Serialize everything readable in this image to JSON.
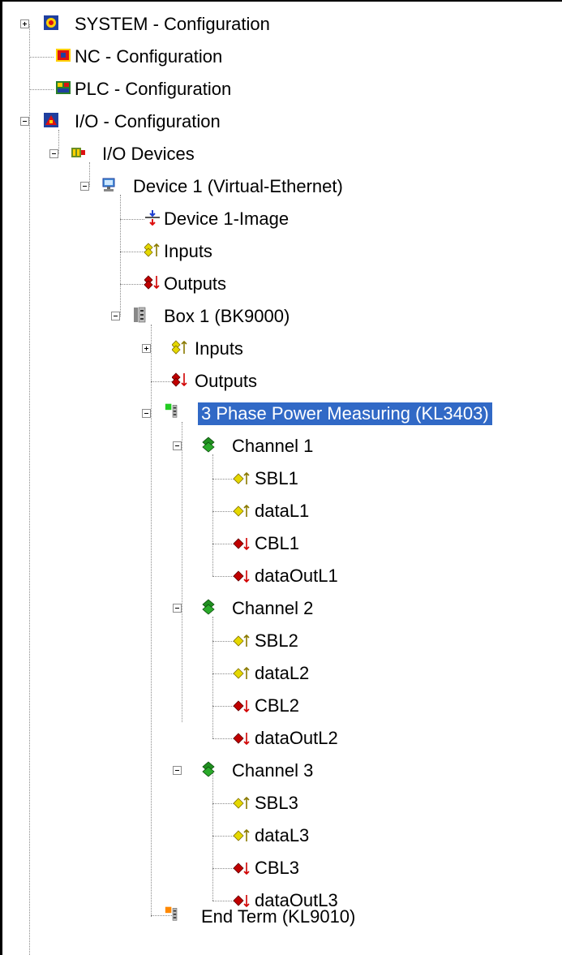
{
  "tree": {
    "system": "SYSTEM - Configuration",
    "nc": "NC - Configuration",
    "plc": "PLC - Configuration",
    "io": "I/O - Configuration",
    "io_devices": "I/O Devices",
    "device1": "Device 1 (Virtual-Ethernet)",
    "device1_image": "Device 1-Image",
    "device1_inputs": "Inputs",
    "device1_outputs": "Outputs",
    "box1": "Box 1 (BK9000)",
    "box1_inputs": "Inputs",
    "box1_outputs": "Outputs",
    "kl3403": "3 Phase Power Measuring (KL3403)",
    "channel1": "Channel 1",
    "sbl1": "SBL1",
    "datal1": "dataL1",
    "cbl1": "CBL1",
    "dataoutl1": "dataOutL1",
    "channel2": "Channel 2",
    "sbl2": "SBL2",
    "datal2": "dataL2",
    "cbl2": "CBL2",
    "dataoutl2": "dataOutL2",
    "channel3": "Channel 3",
    "sbl3": "SBL3",
    "datal3": "dataL3",
    "cbl3": "CBL3",
    "dataoutl3": "dataOutL3",
    "end_term": "End Term (KL9010)"
  },
  "colors": {
    "selection": "#3169c6",
    "input_icon": "#e5d800",
    "output_icon": "#d10000",
    "channel_icon": "#1f8f1f",
    "terminal_active": "#22cc22",
    "terminal_end": "#ff8800"
  },
  "icons": {
    "system": "system-config-icon",
    "nc": "nc-config-icon",
    "plc": "plc-config-icon",
    "io": "io-config-icon",
    "io_devices": "io-devices-icon",
    "device": "network-device-icon",
    "image": "process-image-icon",
    "inputs": "inputs-icon",
    "outputs": "outputs-icon",
    "box": "bus-coupler-icon",
    "terminal": "terminal-icon",
    "channel": "channel-icon",
    "input_var": "input-variable-icon",
    "output_var": "output-variable-icon"
  }
}
